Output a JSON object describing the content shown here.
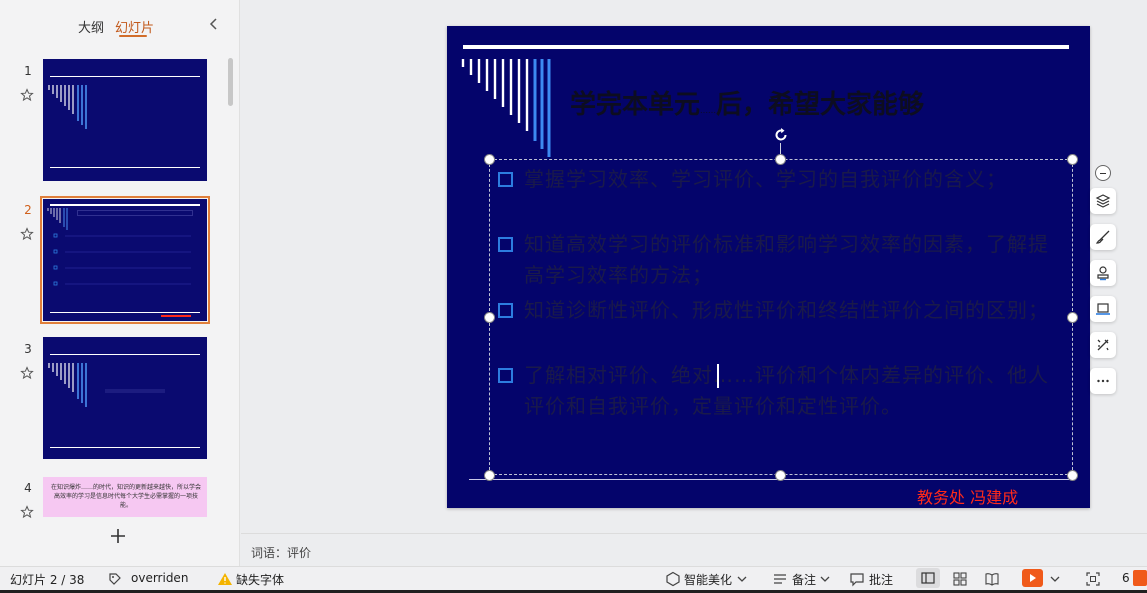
{
  "sidebar": {
    "tab_outline": "大纲",
    "tab_slides": "幻灯片",
    "slide_numbers": [
      "1",
      "2",
      "3",
      "4"
    ],
    "selected_slide": 2,
    "thumb4_text": "在知识爆炸……的时代，知识的更新越来越快，所以学会高效率的学习是信息时代每个大学生必需掌握的一项技能。"
  },
  "slide": {
    "title_main": "学完本单元",
    "title_small": "……",
    "title_tail": "后，希望大家能够",
    "bullets": [
      "掌握学习效率、学习评价、学习的自我评价的含义；",
      "知道高效学习的评价标准和影响学习效率的因素，了解提高学习效率的方法；",
      "知道诊断性评价、形成性评价和终结性评价之间的区别；",
      "了解相对评价、绝对……评价和个体内差异的评价、他人评价和自我评价，定量评价和定性评价。"
    ],
    "footer_name": "教务处  冯建成",
    "colors": {
      "background": "#04046b",
      "bullet": "#2d7de0",
      "footer": "#ff2a1a"
    }
  },
  "notes": {
    "text": "词语：评价"
  },
  "status": {
    "slide_counter": "幻灯片 2 / 38",
    "theme": "overriden",
    "missing_font": "缺失字体",
    "beautify": "智能美化",
    "notes_label": "备注",
    "comments_label": "批注",
    "zoom_label": "6"
  },
  "icons": [
    "star-icon",
    "chevron-left-icon",
    "plus-icon",
    "zoom-minus-icon",
    "layers-icon",
    "brush-icon",
    "stamp-icon",
    "laptop-icon",
    "magic-icon",
    "more-icon",
    "warning-icon",
    "play-icon"
  ]
}
